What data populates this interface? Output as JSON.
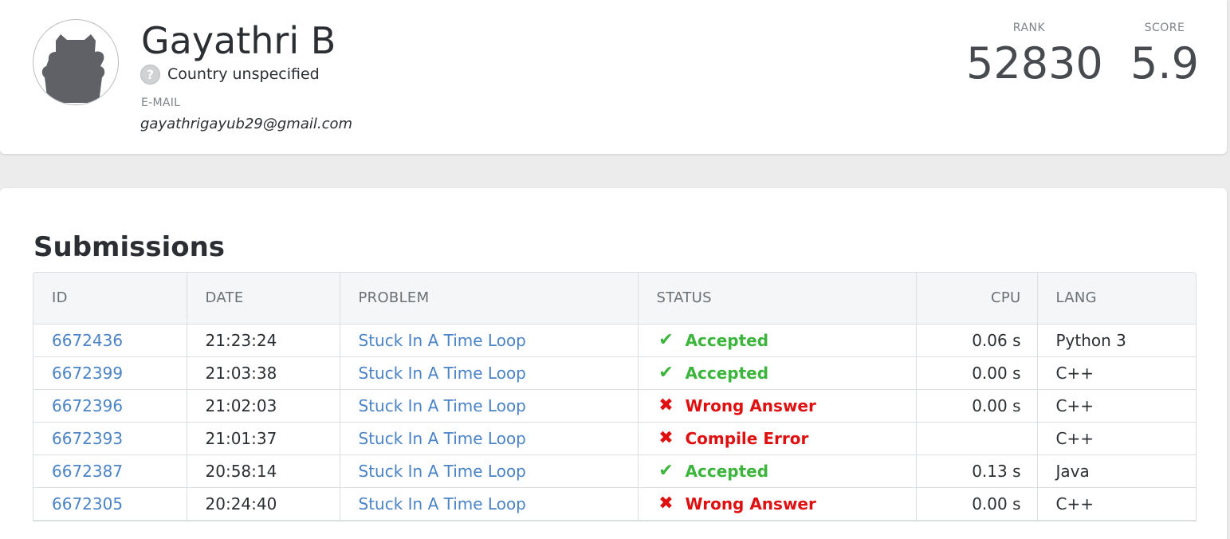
{
  "profile": {
    "name": "Gayathri B",
    "country": "Country unspecified",
    "email_label": "E-MAIL",
    "email": "gayathrigayub29@gmail.com",
    "avatar_icon": "cat-silhouette-icon",
    "country_icon": "question-mark-icon",
    "rank_label": "RANK",
    "rank_value": "52830",
    "score_label": "SCORE",
    "score_value": "5.9"
  },
  "submissions": {
    "title": "Submissions",
    "columns": {
      "id": "ID",
      "date": "DATE",
      "problem": "PROBLEM",
      "status": "STATUS",
      "cpu": "CPU",
      "lang": "LANG"
    },
    "rows": [
      {
        "id": "6672436",
        "date": "21:23:24",
        "problem": "Stuck In A Time Loop",
        "status": "Accepted",
        "status_icon": "checkmark-icon",
        "cpu": "0.06 s",
        "lang": "Python 3"
      },
      {
        "id": "6672399",
        "date": "21:03:38",
        "problem": "Stuck In A Time Loop",
        "status": "Accepted",
        "status_icon": "checkmark-icon",
        "cpu": "0.00 s",
        "lang": "C++"
      },
      {
        "id": "6672396",
        "date": "21:02:03",
        "problem": "Stuck In A Time Loop",
        "status": "Wrong Answer",
        "status_icon": "cross-icon",
        "cpu": "0.00 s",
        "lang": "C++"
      },
      {
        "id": "6672393",
        "date": "21:01:37",
        "problem": "Stuck In A Time Loop",
        "status": "Compile Error",
        "status_icon": "cross-icon",
        "cpu": "",
        "lang": "C++"
      },
      {
        "id": "6672387",
        "date": "20:58:14",
        "problem": "Stuck In A Time Loop",
        "status": "Accepted",
        "status_icon": "checkmark-icon",
        "cpu": "0.13 s",
        "lang": "Java"
      },
      {
        "id": "6672305",
        "date": "20:24:40",
        "problem": "Stuck In A Time Loop",
        "status": "Wrong Answer",
        "status_icon": "cross-icon",
        "cpu": "0.00 s",
        "lang": "C++"
      }
    ]
  },
  "colors": {
    "accepted": "#3cb53c",
    "error": "#e01010",
    "link": "#4a83c6"
  }
}
